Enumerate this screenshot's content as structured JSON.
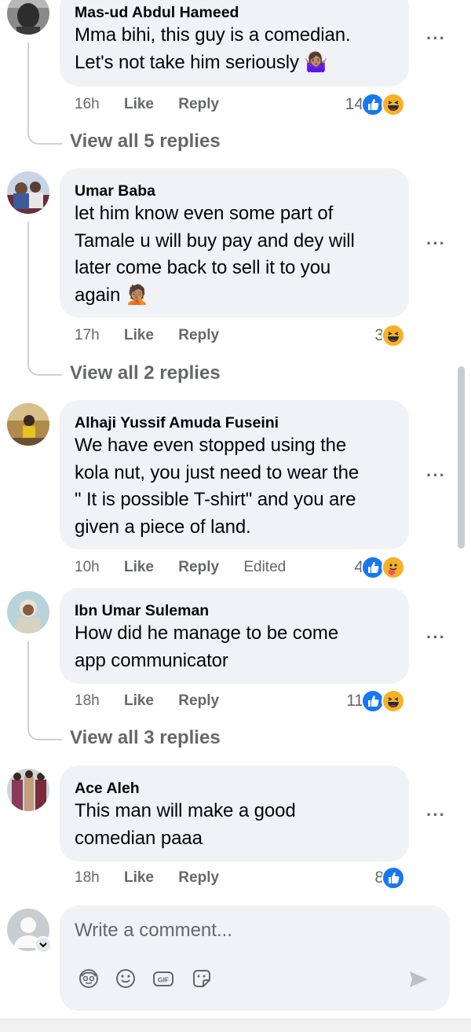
{
  "comments": [
    {
      "author": "Mas-ud Abdul Hameed",
      "lines": [
        "Mma bihi, this guy is a comedian.",
        "Let's not take him seriously 🤷🏽‍♀️"
      ],
      "time": "16h",
      "like": "Like",
      "reply": "Reply",
      "edited": "",
      "reaction_count": "14",
      "reactions": [
        "like-icon",
        "haha-icon"
      ],
      "view_replies": "View all 5 replies"
    },
    {
      "author": "Umar Baba",
      "lines": [
        "let him know even some part of",
        "Tamale u will buy pay and dey will",
        "later come back to sell it to you",
        "again 🤦🏽"
      ],
      "time": "17h",
      "like": "Like",
      "reply": "Reply",
      "edited": "",
      "reaction_count": "3",
      "reactions": [
        "haha-icon"
      ],
      "view_replies": "View all 2 replies"
    },
    {
      "author": "Alhaji Yussif Amuda Fuseini",
      "lines": [
        "We have even stopped using the",
        "kola nut, you just need to wear the",
        "\" It is possible T-shirt\" and you are",
        "given a piece of land."
      ],
      "time": "10h",
      "like": "Like",
      "reply": "Reply",
      "edited": "Edited",
      "reaction_count": "4",
      "reactions": [
        "like-icon",
        "care-icon"
      ],
      "view_replies": ""
    },
    {
      "author": "Ibn Umar Suleman",
      "lines": [
        "How did he manage to be come",
        "app communicator"
      ],
      "time": "18h",
      "like": "Like",
      "reply": "Reply",
      "edited": "",
      "reaction_count": "11",
      "reactions": [
        "like-icon",
        "haha-icon"
      ],
      "view_replies": "View all 3 replies"
    },
    {
      "author": "Ace Aleh",
      "lines": [
        "This man will make a good",
        "comedian paaa"
      ],
      "time": "18h",
      "like": "Like",
      "reply": "Reply",
      "edited": "",
      "reaction_count": "8",
      "reactions": [
        "like-icon"
      ],
      "view_replies": ""
    }
  ],
  "composer": {
    "placeholder": "Write a comment...",
    "tools": [
      "avatar-sticker-icon",
      "emoji-icon",
      "gif-icon",
      "sticker-icon",
      "send-icon"
    ]
  },
  "colors": {
    "bubble": "#f0f2f5",
    "secondary_text": "#65676b",
    "like_blue": "#1877f2",
    "haha_yellow": "#f7b125"
  }
}
